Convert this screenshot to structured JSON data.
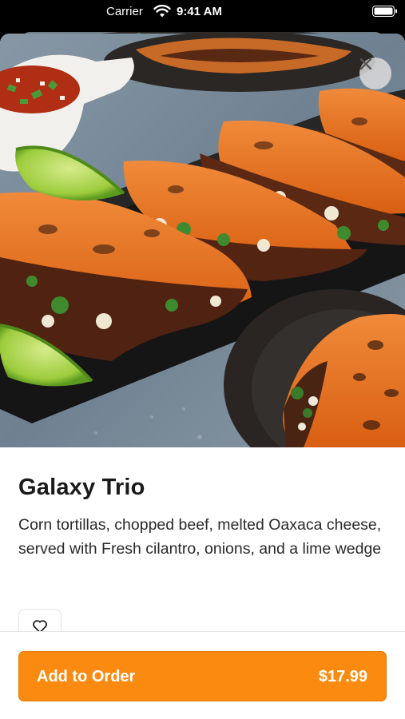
{
  "status_bar": {
    "carrier": "Carrier",
    "time": "9:41 AM"
  },
  "item": {
    "name": "Galaxy Trio",
    "description": "Corn tortillas, chopped beef, melted Oaxaca cheese, served with Fresh cilantro, onions, and a lime wedge"
  },
  "actions": {
    "close_icon": "close-icon",
    "favorite_icon": "heart-icon",
    "add_to_order_label": "Add to Order",
    "price": "$17.99"
  },
  "colors": {
    "accent": "#fb8b10",
    "text": "#1a1a1a"
  }
}
